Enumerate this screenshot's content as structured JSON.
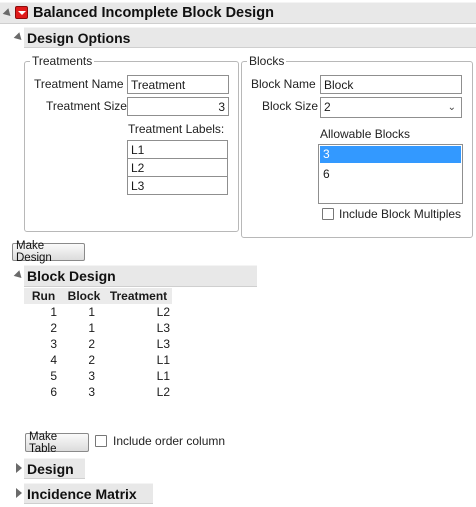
{
  "report": {
    "title": "Balanced Incomplete Block Design"
  },
  "design_options": {
    "title": "Design Options",
    "treatments": {
      "legend": "Treatments",
      "name_label": "Treatment Name",
      "name_value": "Treatment",
      "size_label": "Treatment Size",
      "size_value": "3",
      "labels_label": "Treatment Labels:",
      "labels": [
        "L1",
        "L2",
        "L3"
      ]
    },
    "blocks": {
      "legend": "Blocks",
      "name_label": "Block Name",
      "name_value": "Block",
      "size_label": "Block Size",
      "size_value": "2",
      "allowable_label": "Allowable Blocks",
      "allowable_options": [
        "3",
        "6"
      ],
      "allowable_selected": "3",
      "include_multiples_label": "Include Block Multiples",
      "include_multiples_checked": false
    }
  },
  "make_design_label": "Make Design",
  "block_design": {
    "title": "Block Design",
    "columns": [
      "Run",
      "Block",
      "Treatment"
    ],
    "rows": [
      [
        "1",
        "1",
        "L2"
      ],
      [
        "2",
        "1",
        "L3"
      ],
      [
        "3",
        "2",
        "L3"
      ],
      [
        "4",
        "2",
        "L1"
      ],
      [
        "5",
        "3",
        "L1"
      ],
      [
        "6",
        "3",
        "L2"
      ]
    ],
    "make_table_label": "Make Table",
    "include_order_label": "Include order column",
    "include_order_checked": false
  },
  "design_section": {
    "title": "Design"
  },
  "incidence_section": {
    "title": "Incidence Matrix"
  },
  "colors": {
    "red_button": "#e01a1a",
    "selection": "#3399ff",
    "header_bar": "#e8e8e8"
  }
}
